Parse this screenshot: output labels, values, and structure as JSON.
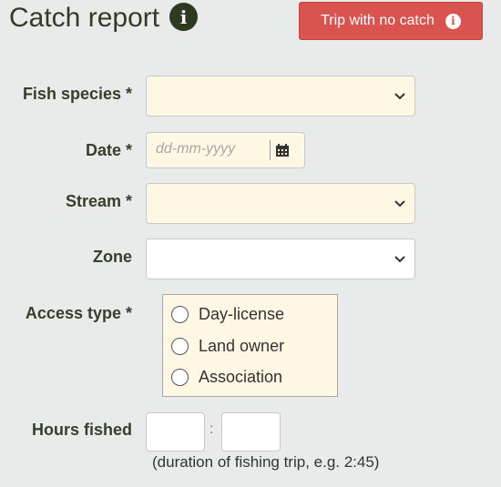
{
  "header": {
    "title": "Catch report",
    "no_catch_button": "Trip with no catch"
  },
  "form": {
    "fish_species_label": "Fish species *",
    "date_label": "Date *",
    "date_placeholder": "dd-mm-yyyy",
    "stream_label": "Stream *",
    "zone_label": "Zone",
    "access_type_label": "Access type *",
    "access_options": [
      "Day-license",
      "Land owner",
      "Association"
    ],
    "hours_fished_label": "Hours fished",
    "hours_separator": ":",
    "hours_hint": "(duration of fishing trip, e.g. 2:45)"
  },
  "icons": {
    "info_glyph": "i",
    "chevron": "chevron-down-icon",
    "calendar": "calendar-icon"
  },
  "colors": {
    "accent_red": "#d9534f",
    "field_bg": "#fdf7e4",
    "text_green": "#33402b"
  }
}
